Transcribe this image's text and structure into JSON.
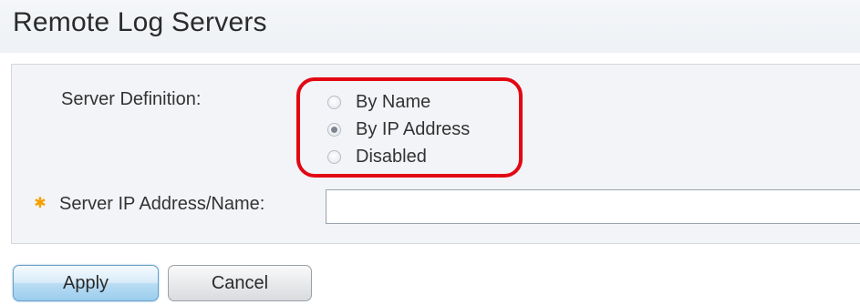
{
  "page": {
    "title": "Remote Log Servers"
  },
  "form": {
    "server_definition": {
      "label": "Server Definition:",
      "options": [
        {
          "label": "By Name",
          "checked": false
        },
        {
          "label": "By IP Address",
          "checked": true
        },
        {
          "label": "Disabled",
          "checked": false
        }
      ]
    },
    "server_address": {
      "label": "Server IP Address/Name:",
      "value": "",
      "required": true,
      "required_icon": "asterisk-star-icon",
      "required_color": "#f5a000"
    }
  },
  "buttons": {
    "apply_label": "Apply",
    "cancel_label": "Cancel"
  },
  "highlight": {
    "color": "#e30613"
  }
}
